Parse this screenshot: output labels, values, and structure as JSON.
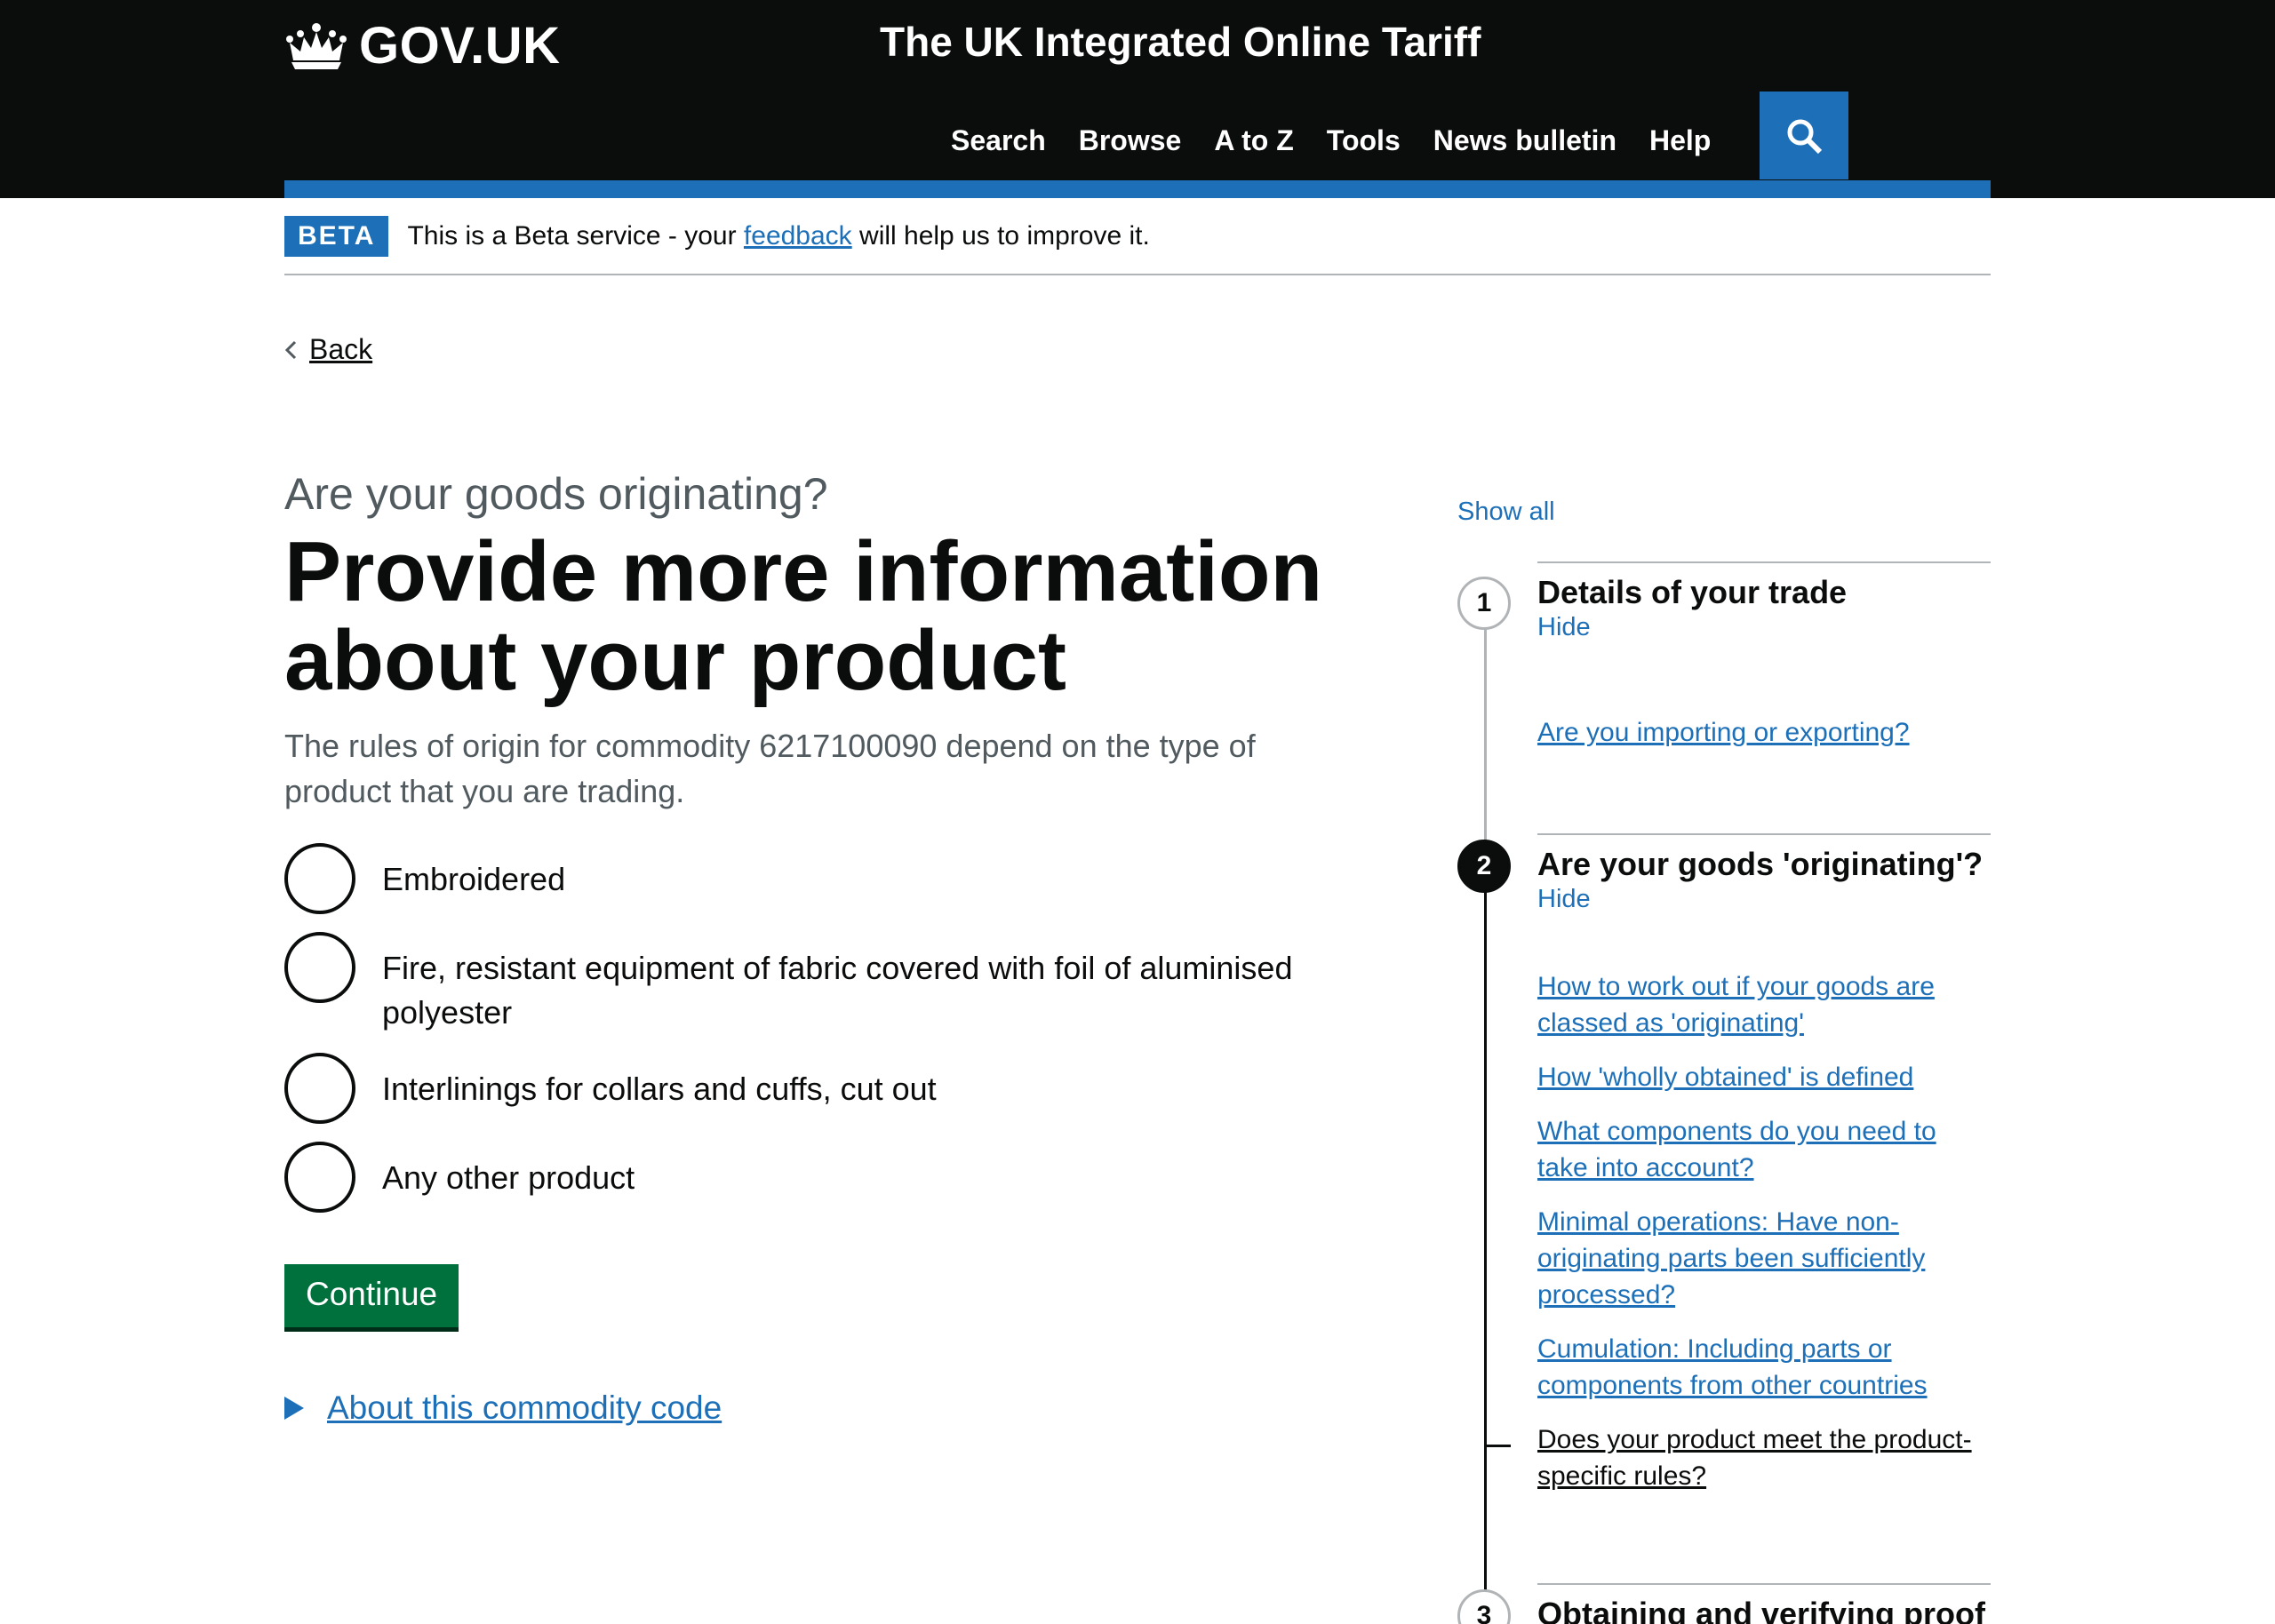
{
  "header": {
    "logo": "GOV.UK",
    "service_name": "The UK Integrated Online Tariff",
    "nav": [
      "Search",
      "Browse",
      "A to Z",
      "Tools",
      "News bulletin",
      "Help"
    ],
    "search_icon": "search-icon"
  },
  "phase_banner": {
    "tag": "BETA",
    "text_before": "This is a Beta service - your ",
    "link": "feedback",
    "text_after": " will help us to improve it."
  },
  "back_link": "Back",
  "main": {
    "caption": "Are your goods originating?",
    "heading": "Provide more information about your product",
    "lead": "The rules of origin for commodity 6217100090 depend on the type of product that you are trading.",
    "options": [
      "Embroidered",
      "Fire, resistant equipment of fabric covered with foil of aluminised polyester",
      "Interlinings for collars and cuffs, cut out",
      "Any other product"
    ],
    "continue_label": "Continue",
    "details_summary": "About this commodity code"
  },
  "sidebar": {
    "show_all": "Show all",
    "steps": [
      {
        "number": "1",
        "title": "Details of your trade",
        "toggle": "Hide",
        "links": [
          "Are you importing or exporting?"
        ]
      },
      {
        "number": "2",
        "title": "Are your goods 'originating'?",
        "toggle": "Hide",
        "links": [
          "How to work out if your goods are classed as 'originating'",
          "How 'wholly obtained' is defined",
          "What components do you need to take into account?",
          "Minimal operations: Have non-originating parts been sufficiently processed?",
          "Cumulation: Including parts or components from other countries",
          "Does your product meet the product-specific rules?"
        ]
      },
      {
        "number": "3",
        "title": "Obtaining and verifying proof"
      }
    ]
  }
}
